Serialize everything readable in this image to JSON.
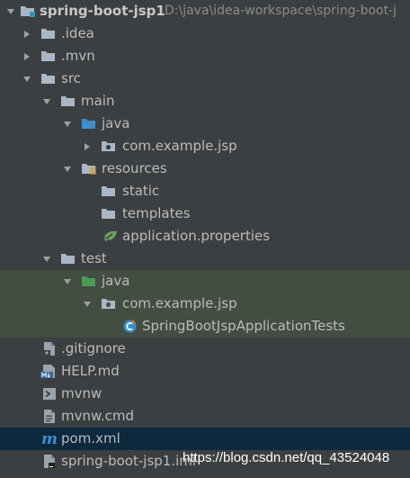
{
  "tree": {
    "root": {
      "name": "spring-boot-jsp1",
      "path": "D:\\java\\idea-workspace\\spring-boot-j"
    },
    "idea": ".idea",
    "mvn": ".mvn",
    "src": "src",
    "main": "main",
    "main_java": "java",
    "main_pkg": "com.example.jsp",
    "resources": "resources",
    "static": "static",
    "templates": "templates",
    "app_props": "application.properties",
    "test": "test",
    "test_java": "java",
    "test_pkg": "com.example.jsp",
    "test_class": "SpringBootJspApplicationTests",
    "gitignore": ".gitignore",
    "help": "HELP.md",
    "mvnw": "mvnw",
    "mvnw_cmd": "mvnw.cmd",
    "pom": "pom.xml",
    "iml": "spring-boot-jsp1.iml"
  },
  "watermark": "https://blog.csdn.net/qq_43524048",
  "colors": {
    "background": "#3c3f41",
    "folder": "#a9b7c6",
    "source_folder": "#5394ec",
    "test_folder": "#499c54",
    "selection": "#0d293e",
    "test_highlight": "#434d42"
  }
}
